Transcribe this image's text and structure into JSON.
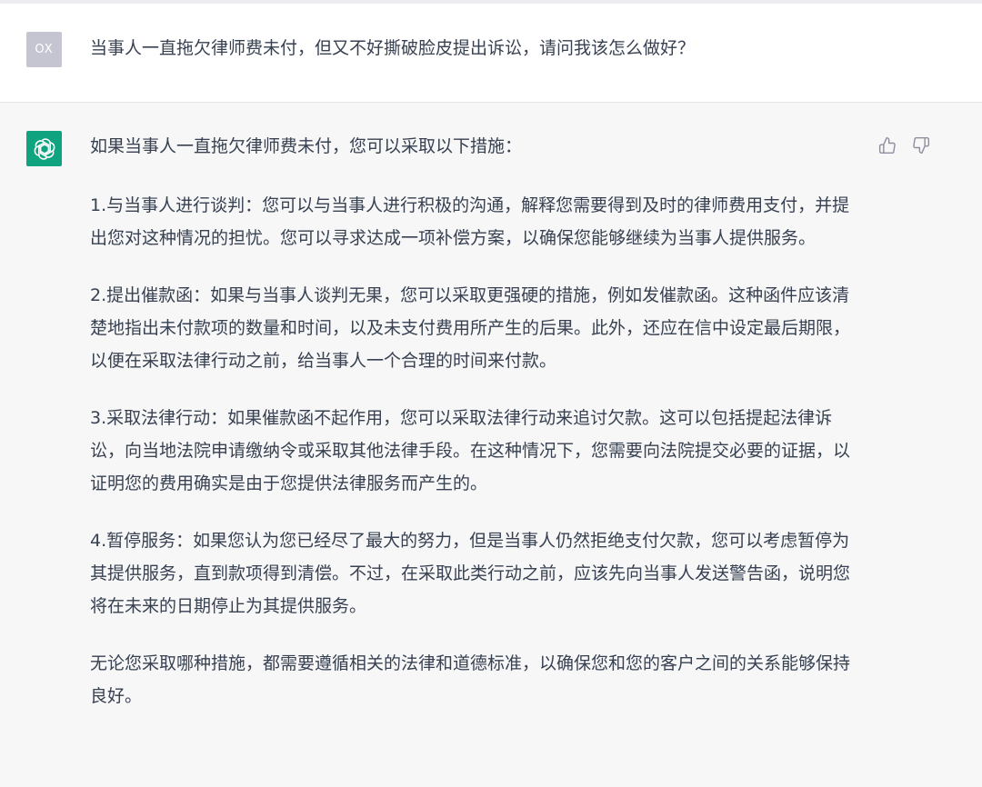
{
  "user_message": {
    "avatar_initials": "OX",
    "text": "当事人一直拖欠律师费未付，但又不好撕破脸皮提出诉讼，请问我该怎么做好？"
  },
  "assistant_message": {
    "avatar_icon": "openai-logo-icon",
    "intro": "如果当事人一直拖欠律师费未付，您可以采取以下措施：",
    "points": [
      "1.与当事人进行谈判：您可以与当事人进行积极的沟通，解释您需要得到及时的律师费用支付，并提出您对这种情况的担忧。您可以寻求达成一项补偿方案，以确保您能够继续为当事人提供服务。",
      "2.提出催款函：如果与当事人谈判无果，您可以采取更强硬的措施，例如发催款函。这种函件应该清楚地指出未付款项的数量和时间，以及未支付费用所产生的后果。此外，还应在信中设定最后期限，以便在采取法律行动之前，给当事人一个合理的时间来付款。",
      "3.采取法律行动：如果催款函不起作用，您可以采取法律行动来追讨欠款。这可以包括提起法律诉讼，向当地法院申请缴纳令或采取其他法律手段。在这种情况下，您需要向法院提交必要的证据，以证明您的费用确实是由于您提供法律服务而产生的。",
      "4.暂停服务：如果您认为您已经尽了最大的努力，但是当事人仍然拒绝支付欠款，您可以考虑暂停为其提供服务，直到款项得到清偿。不过，在采取此类行动之前，应该先向当事人发送警告函，说明您将在未来的日期停止为其提供服务。"
    ],
    "conclusion": "无论您采取哪种措施，都需要遵循相关的法律和道德标准，以确保您和您的客户之间的关系能够保持良好。",
    "feedback_icons": [
      "thumbs-up-icon",
      "thumbs-down-icon"
    ]
  },
  "colors": {
    "page_background": "#f7f7f8",
    "user_row_background": "#ffffff",
    "user_avatar": "#c5c5d2",
    "assistant_avatar": "#10a37f",
    "text": "#374151",
    "icon": "#8e8ea0"
  }
}
